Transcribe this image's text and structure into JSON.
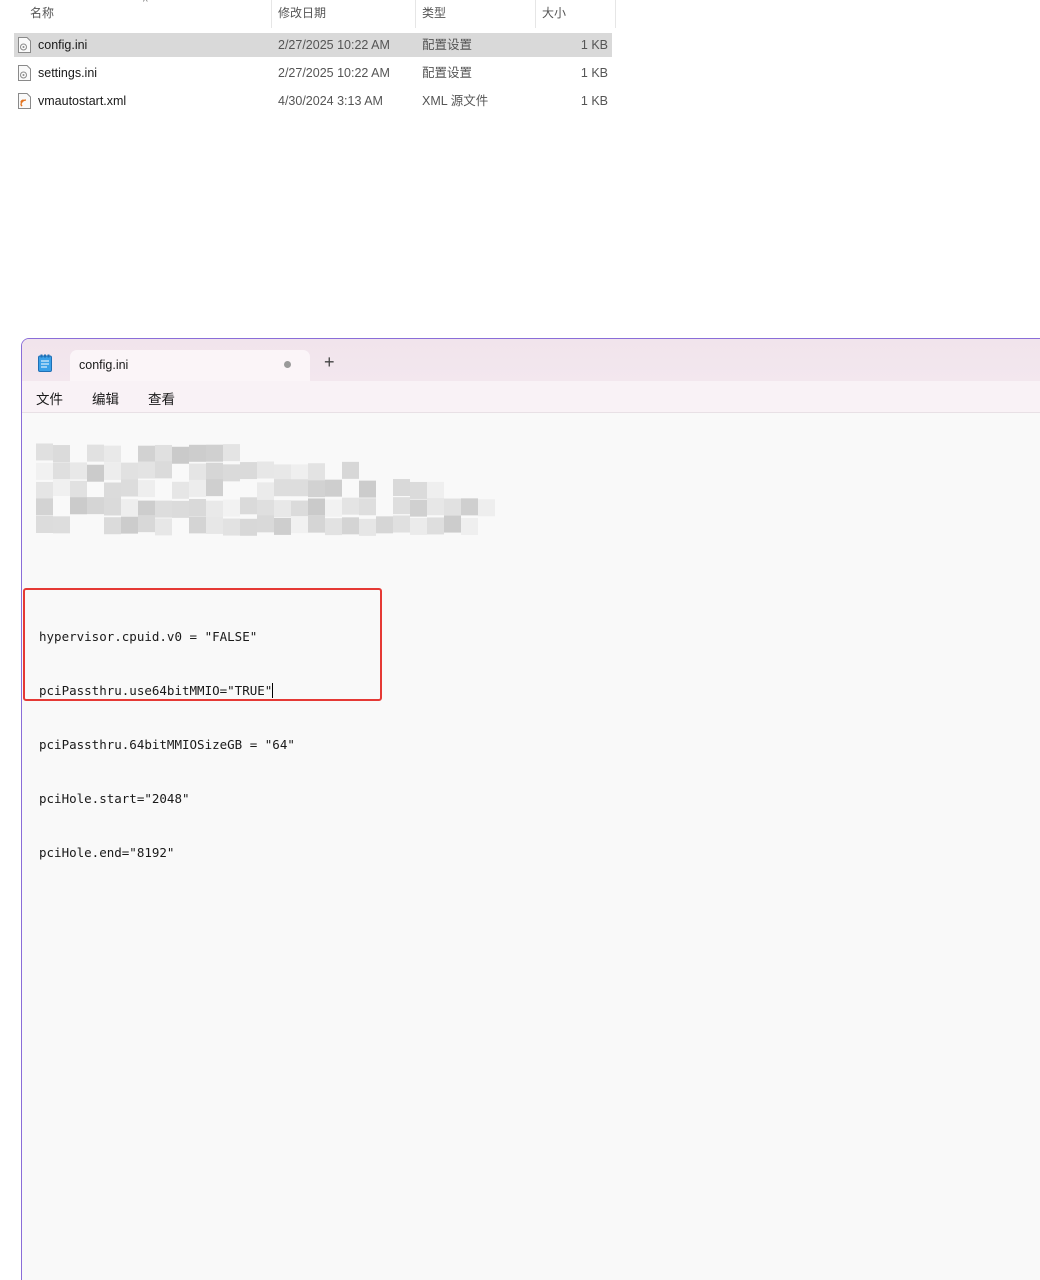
{
  "explorer": {
    "columns": {
      "name": "名称",
      "modified": "修改日期",
      "type": "类型",
      "size": "大小"
    },
    "files": [
      {
        "name": "config.ini",
        "modified": "2/27/2025 10:22 AM",
        "type": "配置设置",
        "size": "1 KB",
        "icon": "ini-file-icon",
        "selected": true
      },
      {
        "name": "settings.ini",
        "modified": "2/27/2025 10:22 AM",
        "type": "配置设置",
        "size": "1 KB",
        "icon": "ini-file-icon",
        "selected": false
      },
      {
        "name": "vmautostart.xml",
        "modified": "4/30/2024 3:13 AM",
        "type": "XML 源文件",
        "size": "1 KB",
        "icon": "xml-file-icon",
        "selected": false
      }
    ]
  },
  "notepad": {
    "tab_title": "config.ini",
    "new_tab_label": "+",
    "menu": {
      "file": "文件",
      "edit": "编辑",
      "view": "查看"
    },
    "content_lines": [
      "hypervisor.cpuid.v0 = \"FALSE\"",
      "pciPassthru.use64bitMMIO=\"TRUE\"",
      "pciPassthru.64bitMMIOSizeGB = \"64\"",
      "pciHole.start=\"2048\"",
      "pciHole.end=\"8192\""
    ],
    "accent_color": "#8a6dd8",
    "highlight_color": "#e53935"
  }
}
